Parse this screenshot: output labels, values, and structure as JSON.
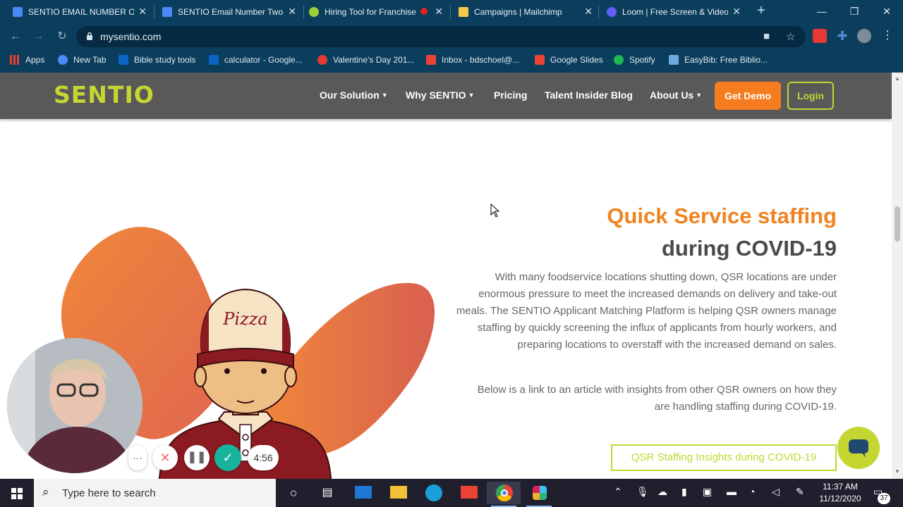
{
  "browser": {
    "tabs": [
      {
        "title": "SENTIO EMAIL NUMBER ONE",
        "icon": "google-docs-icon"
      },
      {
        "title": "SENTIO Email Number Two",
        "icon": "google-docs-icon"
      },
      {
        "title": "Hiring Tool for Franchise",
        "icon": "sentio-icon"
      },
      {
        "title": "Campaigns | Mailchimp",
        "icon": "mailchimp-icon"
      },
      {
        "title": "Loom | Free Screen & Video",
        "icon": "loom-icon"
      }
    ],
    "url": "mysentio.com",
    "bookmarks": [
      {
        "label": "Apps",
        "icon": "apps-grid-icon"
      },
      {
        "label": "New Tab",
        "icon": "globe-icon"
      },
      {
        "label": "Bible study tools",
        "icon": "linkedin-icon"
      },
      {
        "label": "calculator - Google...",
        "icon": "linkedin-icon"
      },
      {
        "label": "Valentine's Day 201...",
        "icon": "pin-icon"
      },
      {
        "label": "Inbox - bdschoel@...",
        "icon": "gmail-icon"
      },
      {
        "label": "Google Slides",
        "icon": "gmail-icon"
      },
      {
        "label": "Spotify",
        "icon": "spotify-icon"
      },
      {
        "label": "EasyBib: Free Biblio...",
        "icon": "easybib-icon"
      }
    ]
  },
  "site": {
    "logo": "SENTIO",
    "nav": [
      {
        "label": "Our Solution",
        "dropdown": true
      },
      {
        "label": "Why SENTIO",
        "dropdown": true
      },
      {
        "label": "Pricing",
        "dropdown": false
      },
      {
        "label": "Talent Insider Blog",
        "dropdown": false
      },
      {
        "label": "About Us",
        "dropdown": true
      }
    ],
    "get_demo": "Get Demo",
    "login": "Login",
    "heading_line1": "Quick Service staffing",
    "heading_line2": "during COVID-19",
    "paragraph1": "With many foodservice locations shutting down, QSR locations are under enormous pressure to meet the increased demands on delivery and take-out meals. The SENTIO Applicant Matching Platform is helping QSR owners manage staffing by quickly screening the influx of applicants from hourly workers, and preparing locations to overstaff with the increased demand on sales.",
    "paragraph2": "Below is a link to an article with insights from other QSR owners on how they are handling staffing during COVID-19.",
    "cta": "QSR Staffing Insights during COVID-19",
    "hat_text": "Pizza"
  },
  "loom": {
    "timer": "4:56"
  },
  "taskbar": {
    "search_placeholder": "Type here to search",
    "time": "11:37 AM",
    "date": "11/12/2020",
    "notification_count": "37"
  },
  "colors": {
    "brand_green": "#c5d633",
    "brand_orange": "#f08321",
    "chrome_blue": "#0b3d5c"
  }
}
